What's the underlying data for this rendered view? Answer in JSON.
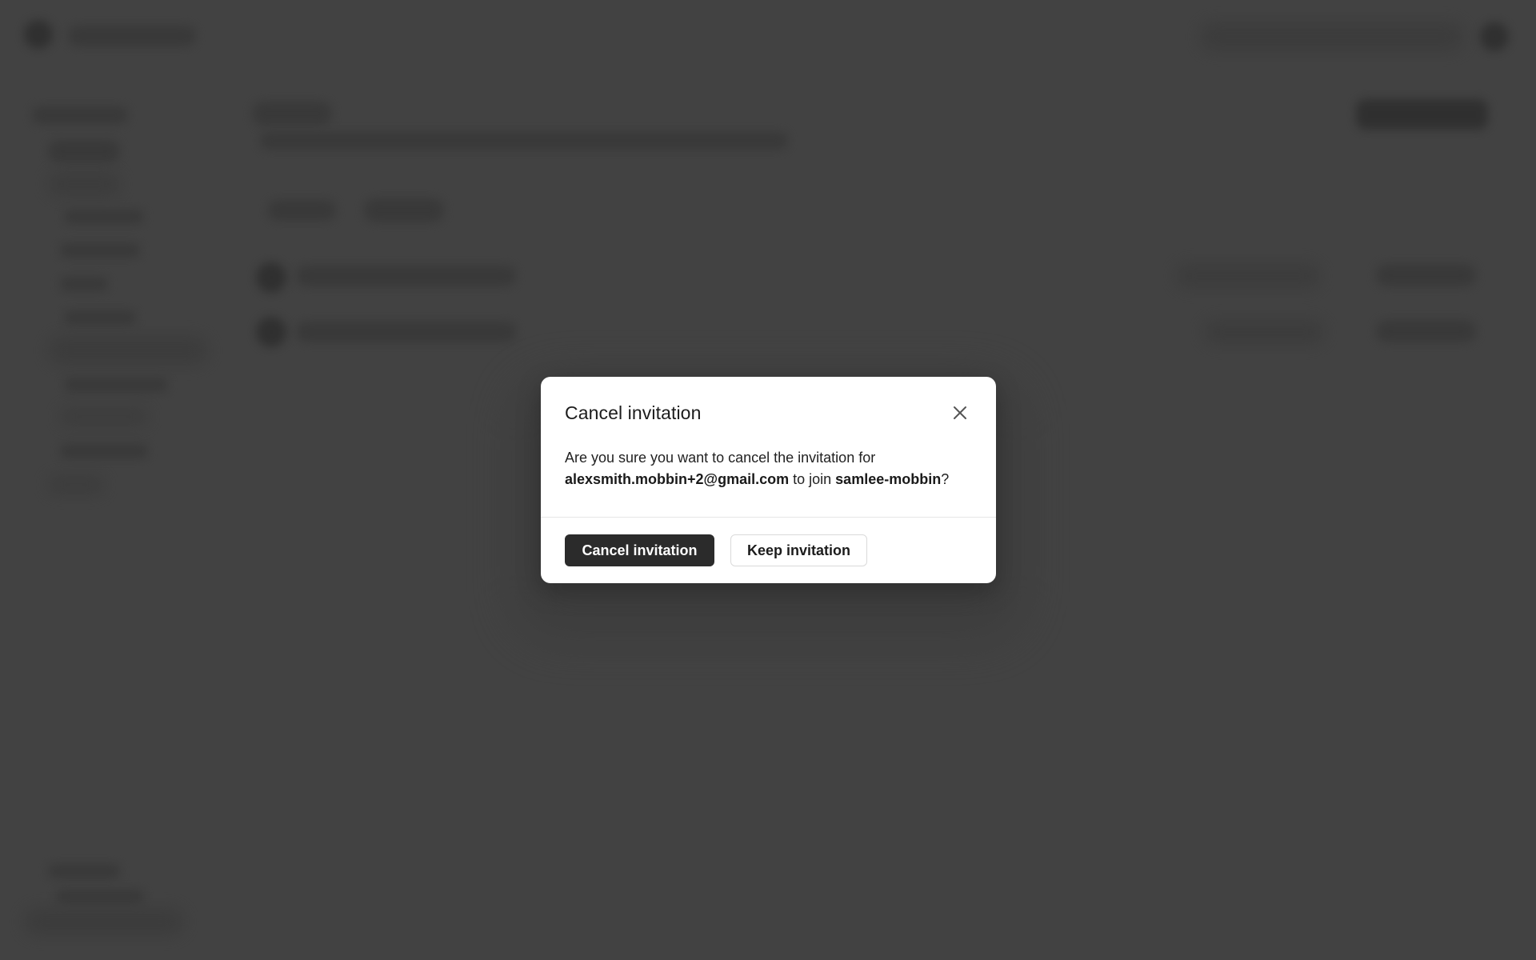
{
  "dialog": {
    "title": "Cancel invitation",
    "message_prefix": "Are you sure you want to cancel the invitation for",
    "email": "alexsmith.mobbin+2@gmail.com",
    "message_middle": " to join ",
    "workspace": "samlee-mobbin",
    "message_suffix": "?",
    "primary_button": "Cancel invitation",
    "secondary_button": "Keep invitation",
    "close_icon": "close-icon"
  },
  "colors": {
    "overlay": "#424242",
    "modal_background": "#ffffff",
    "primary_button_background": "#2b2b2b",
    "primary_button_text": "#ffffff",
    "text": "#222222"
  }
}
